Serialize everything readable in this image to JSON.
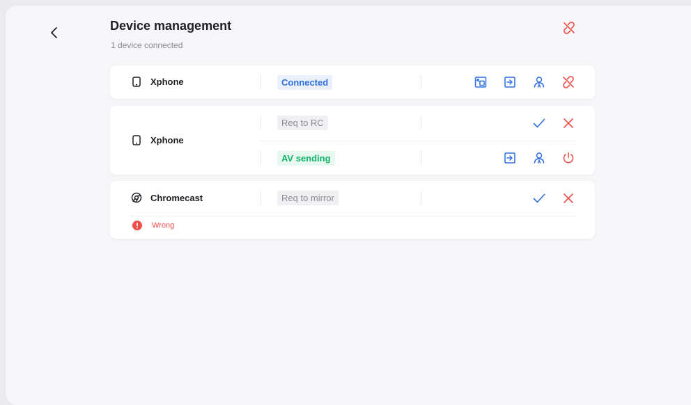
{
  "header": {
    "title": "Device management",
    "subtitle": "1 device connected"
  },
  "colors": {
    "blue": "#2f6ee0",
    "red": "#f0504a",
    "green": "#17b26a"
  },
  "devices": [
    {
      "name": "Xphone",
      "icon": "phone-icon",
      "status": "Connected",
      "actions": [
        "screen-share-icon",
        "file-transfer-icon",
        "user-icon",
        "disconnect-icon"
      ]
    },
    {
      "name": "Xphone",
      "icon": "phone-icon",
      "requests": [
        {
          "status": "Req to RC",
          "actions": [
            "accept-check-icon",
            "reject-x-icon"
          ]
        },
        {
          "status": "AV sending",
          "actions": [
            "file-transfer-icon",
            "user-icon",
            "power-icon"
          ]
        }
      ]
    },
    {
      "name": "Chromecast",
      "icon": "chrome-icon",
      "status": "Req to mirror",
      "actions": [
        "accept-check-icon",
        "reject-x-icon"
      ],
      "error": "Wrong"
    }
  ]
}
